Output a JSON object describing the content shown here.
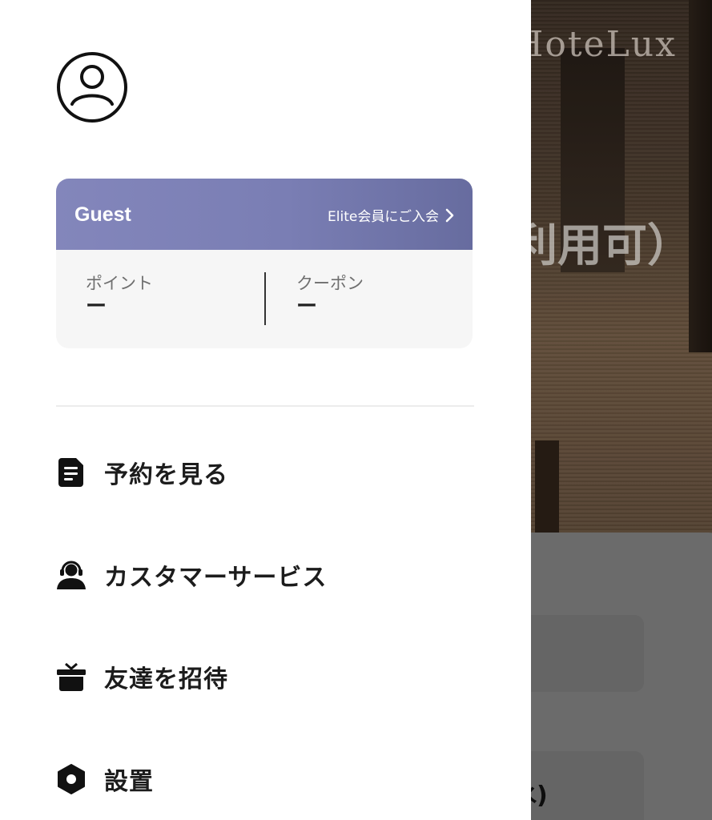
{
  "background": {
    "brand": "HoteLux",
    "headline": "利用可）",
    "date_fragment": "水)"
  },
  "drawer": {
    "avatar_icon": "user-circle-icon",
    "member_card": {
      "name": "Guest",
      "elite_link_label": "Elite会員にご入会",
      "points_label": "ポイント",
      "points_value": "ー",
      "coupons_label": "クーポン",
      "coupons_value": "ー"
    },
    "menu": [
      {
        "id": "reservations",
        "label": "予約を見る",
        "icon": "document-icon"
      },
      {
        "id": "support",
        "label": "カスタマーサービス",
        "icon": "headset-agent-icon"
      },
      {
        "id": "invite",
        "label": "友達を招待",
        "icon": "gift-icon"
      },
      {
        "id": "settings",
        "label": "設置",
        "icon": "gear-icon"
      }
    ]
  },
  "colors": {
    "card_gradient_start": "#8386bb",
    "card_gradient_end": "#676c9f",
    "drawer_bg": "#ffffff"
  }
}
